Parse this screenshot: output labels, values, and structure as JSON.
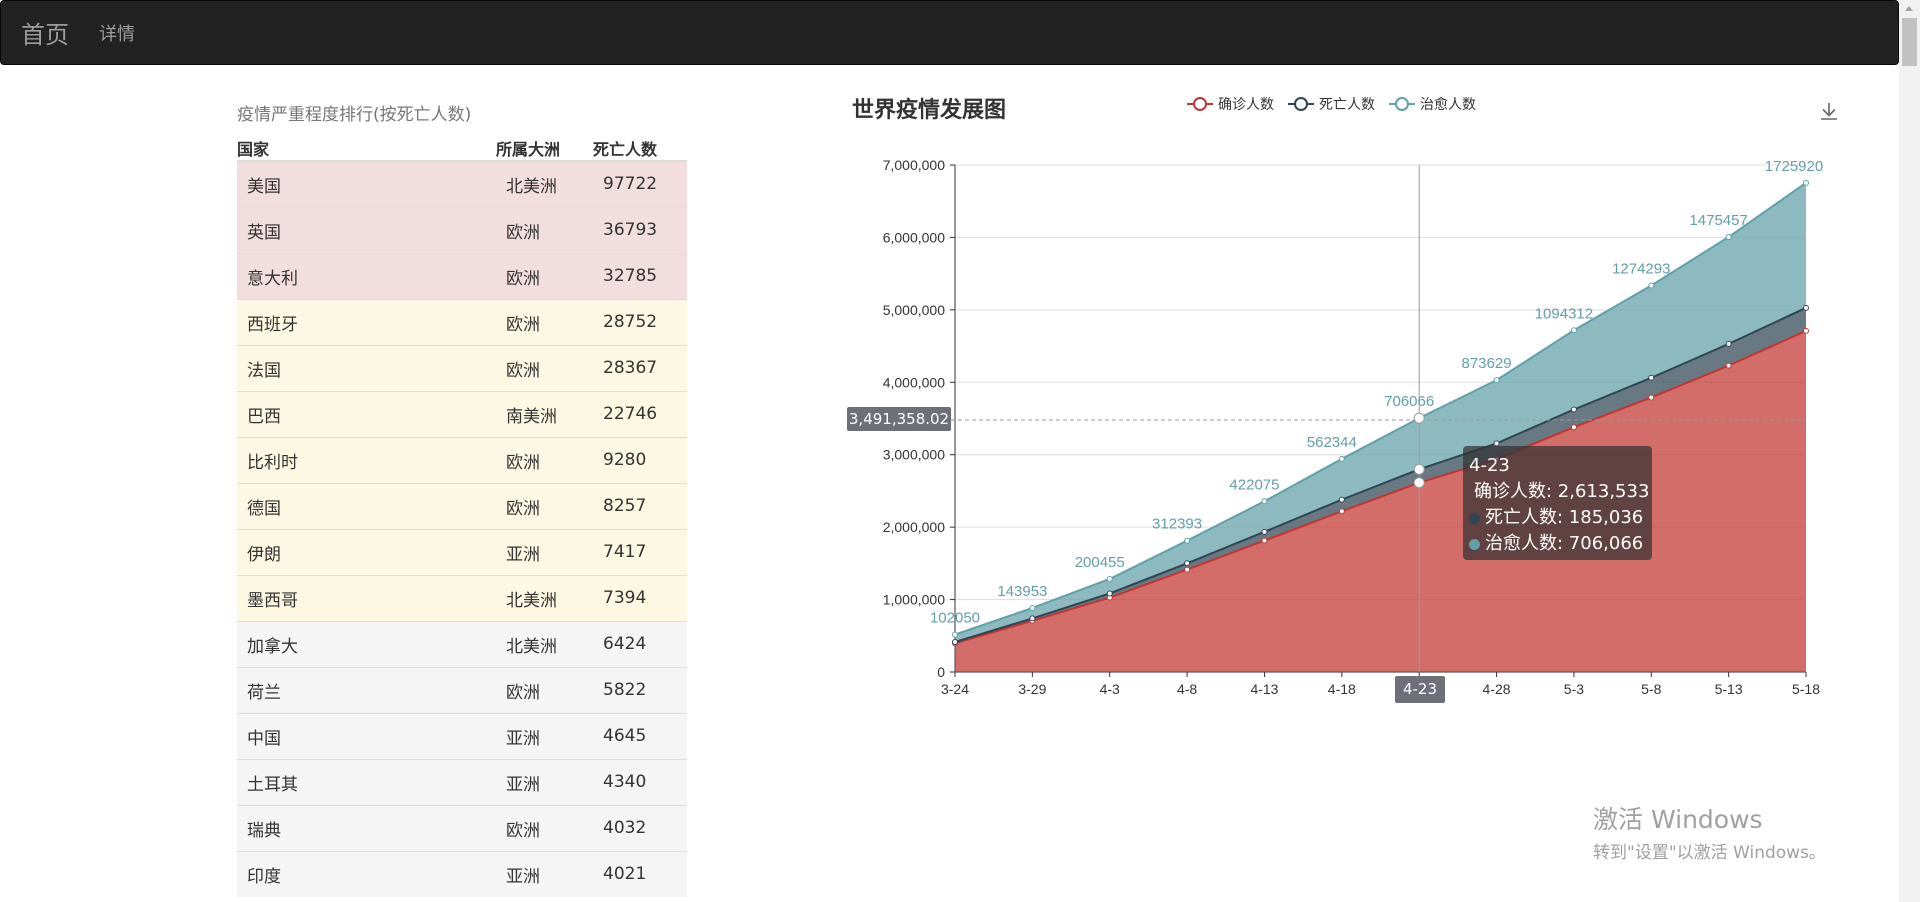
{
  "navbar": {
    "brand": "首页",
    "links": [
      "详情"
    ]
  },
  "ranking": {
    "caption": "疫情严重程度排行(按死亡人数)",
    "headers": {
      "country": "国家",
      "continent": "所属大洲",
      "deaths": "死亡人数"
    },
    "rows": [
      {
        "country": "美国",
        "continent": "北美洲",
        "deaths": "97722",
        "level": "danger"
      },
      {
        "country": "英国",
        "continent": "欧洲",
        "deaths": "36793",
        "level": "danger"
      },
      {
        "country": "意大利",
        "continent": "欧洲",
        "deaths": "32785",
        "level": "danger"
      },
      {
        "country": "西班牙",
        "continent": "欧洲",
        "deaths": "28752",
        "level": "warning"
      },
      {
        "country": "法国",
        "continent": "欧洲",
        "deaths": "28367",
        "level": "warning"
      },
      {
        "country": "巴西",
        "continent": "南美洲",
        "deaths": "22746",
        "level": "warning"
      },
      {
        "country": "比利时",
        "continent": "欧洲",
        "deaths": "9280",
        "level": "warning"
      },
      {
        "country": "德国",
        "continent": "欧洲",
        "deaths": "8257",
        "level": "warning"
      },
      {
        "country": "伊朗",
        "continent": "亚洲",
        "deaths": "7417",
        "level": "warning"
      },
      {
        "country": "墨西哥",
        "continent": "北美洲",
        "deaths": "7394",
        "level": "warning"
      },
      {
        "country": "加拿大",
        "continent": "北美洲",
        "deaths": "6424",
        "level": "active"
      },
      {
        "country": "荷兰",
        "continent": "欧洲",
        "deaths": "5822",
        "level": "active"
      },
      {
        "country": "中国",
        "continent": "亚洲",
        "deaths": "4645",
        "level": "active"
      },
      {
        "country": "土耳其",
        "continent": "亚洲",
        "deaths": "4340",
        "level": "active"
      },
      {
        "country": "瑞典",
        "continent": "欧洲",
        "deaths": "4032",
        "level": "active"
      },
      {
        "country": "印度",
        "continent": "亚洲",
        "deaths": "4021",
        "level": "active"
      }
    ]
  },
  "chart_data": {
    "type": "area",
    "title": "世界疫情发展图",
    "stacked": true,
    "categories": [
      "3-24",
      "3-29",
      "4-3",
      "4-8",
      "4-13",
      "4-18",
      "4-23",
      "4-28",
      "5-3",
      "5-8",
      "5-13",
      "5-18"
    ],
    "series": [
      {
        "name": "确诊人数",
        "color": "#c23531",
        "values": [
          397000,
          707000,
          1028000,
          1414000,
          1814000,
          2220000,
          2613533,
          2940000,
          3380000,
          3790000,
          4230000,
          4710000
        ]
      },
      {
        "name": "死亡人数",
        "color": "#2f4554",
        "values": [
          17000,
          33000,
          56000,
          87000,
          121000,
          160000,
          185036,
          216000,
          244000,
          272000,
          300000,
          318000
        ]
      },
      {
        "name": "治愈人数",
        "color": "#61a0a8",
        "values": [
          102050,
          143953,
          200455,
          312393,
          422075,
          562344,
          706066,
          873629,
          1094312,
          1274293,
          1475457,
          1725920
        ]
      }
    ],
    "data_labels": [
      "102050",
      "143953",
      "200455",
      "312393",
      "422075",
      "562344",
      "706066",
      "873629",
      "1094312",
      "1274293",
      "1475457",
      "1725920"
    ],
    "ylim": [
      0,
      7000000
    ],
    "yticks": [
      "0",
      "1,000,000",
      "2,000,000",
      "3,000,000",
      "4,000,000",
      "5,000,000",
      "6,000,000",
      "7,000,000"
    ],
    "grid": true,
    "legend_position": "top"
  },
  "tooltip": {
    "title": "4-23",
    "rows": [
      {
        "label": "确诊人数: 2,613,533",
        "color": "#c23531"
      },
      {
        "label": "死亡人数: 185,036",
        "color": "#2f4554"
      },
      {
        "label": "治愈人数: 706,066",
        "color": "#61a0a8"
      }
    ]
  },
  "axis_pointer": {
    "y_value": "3,491,358.02",
    "x_value": "4-23"
  },
  "watermark": {
    "line1": "激活 Windows",
    "line2": "转到\"设置\"以激活 Windows。"
  },
  "icons": {
    "download": "download-icon"
  }
}
